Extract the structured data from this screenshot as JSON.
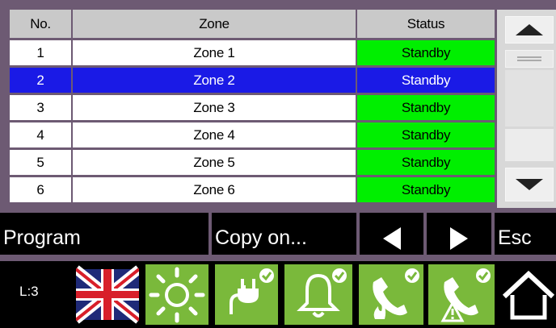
{
  "table": {
    "headers": {
      "no": "No.",
      "zone": "Zone",
      "status": "Status"
    },
    "rows": [
      {
        "no": "1",
        "zone": "Zone 1",
        "status": "Standby",
        "selected": false
      },
      {
        "no": "2",
        "zone": "Zone 2",
        "status": "Standby",
        "selected": true
      },
      {
        "no": "3",
        "zone": "Zone 3",
        "status": "Standby",
        "selected": false
      },
      {
        "no": "4",
        "zone": "Zone 4",
        "status": "Standby",
        "selected": false
      },
      {
        "no": "5",
        "zone": "Zone 5",
        "status": "Standby",
        "selected": false
      },
      {
        "no": "6",
        "zone": "Zone 6",
        "status": "Standby",
        "selected": false
      }
    ]
  },
  "toolbar": {
    "program_label": "Program",
    "copy_label": "Copy on...",
    "esc_label": "Esc"
  },
  "status_bar": {
    "level_label": "L:3",
    "icons": [
      "uk-flag-icon",
      "sun-icon",
      "power-plug-check-icon",
      "bell-check-icon",
      "phone-fire-check-icon",
      "phone-warning-check-icon",
      "home-icon"
    ]
  },
  "colors": {
    "background": "#6d5a73",
    "standby_green": "#00ef00",
    "selection_blue": "#1a1ae6",
    "tile_green": "#7ab93b"
  }
}
